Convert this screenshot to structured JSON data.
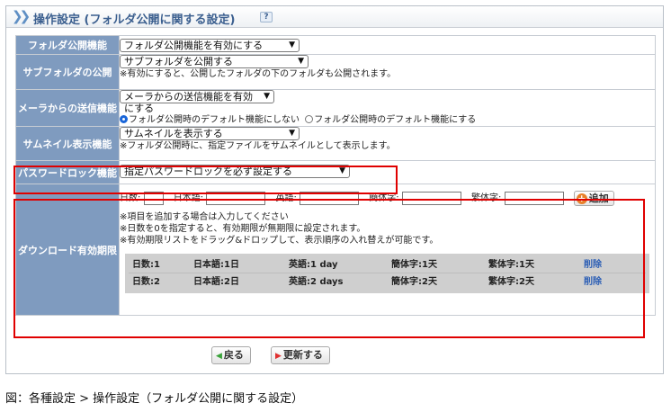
{
  "header": {
    "title": "操作設定 (フォルダ公開に関する設定)",
    "help": "?"
  },
  "rows": {
    "folder_public": {
      "label": "フォルダ公開機能",
      "select": "フォルダ公開機能を有効にする"
    },
    "subfolder": {
      "label": "サブフォルダの公開",
      "select": "サブフォルダを公開する",
      "note": "※有効にすると、公開したフォルダの下のフォルダも公開されます。"
    },
    "mailer": {
      "label": "メーラからの送信機能",
      "select": "メーラからの送信機能を有効にする",
      "radio1": "フォルダ公開時のデフォルト機能にしない",
      "radio2": "フォルダ公開時のデフォルト機能にする"
    },
    "thumbnail": {
      "label": "サムネイル表示機能",
      "select": "サムネイルを表示する",
      "note": "※フォルダ公開時に、指定ファイルをサムネイルとして表示します。"
    },
    "password": {
      "label": "パスワードロック機能",
      "select": "指定パスワードロックを必ず設定する"
    },
    "download": {
      "label": "ダウンロード有効期限",
      "fields": {
        "days": "日数:",
        "ja": "日本語:",
        "en": "英語:",
        "zh_s": "簡体字:",
        "zh_t": "繁体字:"
      },
      "add_label": "追加",
      "notes": [
        "※項目を追加する場合は入力してください",
        "※日数を0を指定すると、有効期限が無期限に設定されます。",
        "※有効期限リストをドラッグ&ドロップして、表示順序の入れ替えが可能です。"
      ],
      "list": [
        {
          "days": "日数:1",
          "ja": "日本語:1日",
          "en": "英語:1 day",
          "zh_s": "簡体字:1天",
          "zh_t": "繁体字:1天",
          "del": "削除"
        },
        {
          "days": "日数:2",
          "ja": "日本語:2日",
          "en": "英語:2 days",
          "zh_s": "簡体字:2天",
          "zh_t": "繁体字:2天",
          "del": "削除"
        }
      ]
    }
  },
  "buttons": {
    "back": "戻る",
    "update": "更新する"
  },
  "caption": "図：各種設定 > 操作設定（フォルダ公開に関する設定）",
  "colors": {
    "label_bg": "#7f9bbf",
    "title_text": "#3b5f8f",
    "highlight": "#e00000",
    "delete_link": "#2d5fb5",
    "add_icon": "#e8802b",
    "back_icon": "#3aa33a",
    "update_icon": "#e03030"
  }
}
